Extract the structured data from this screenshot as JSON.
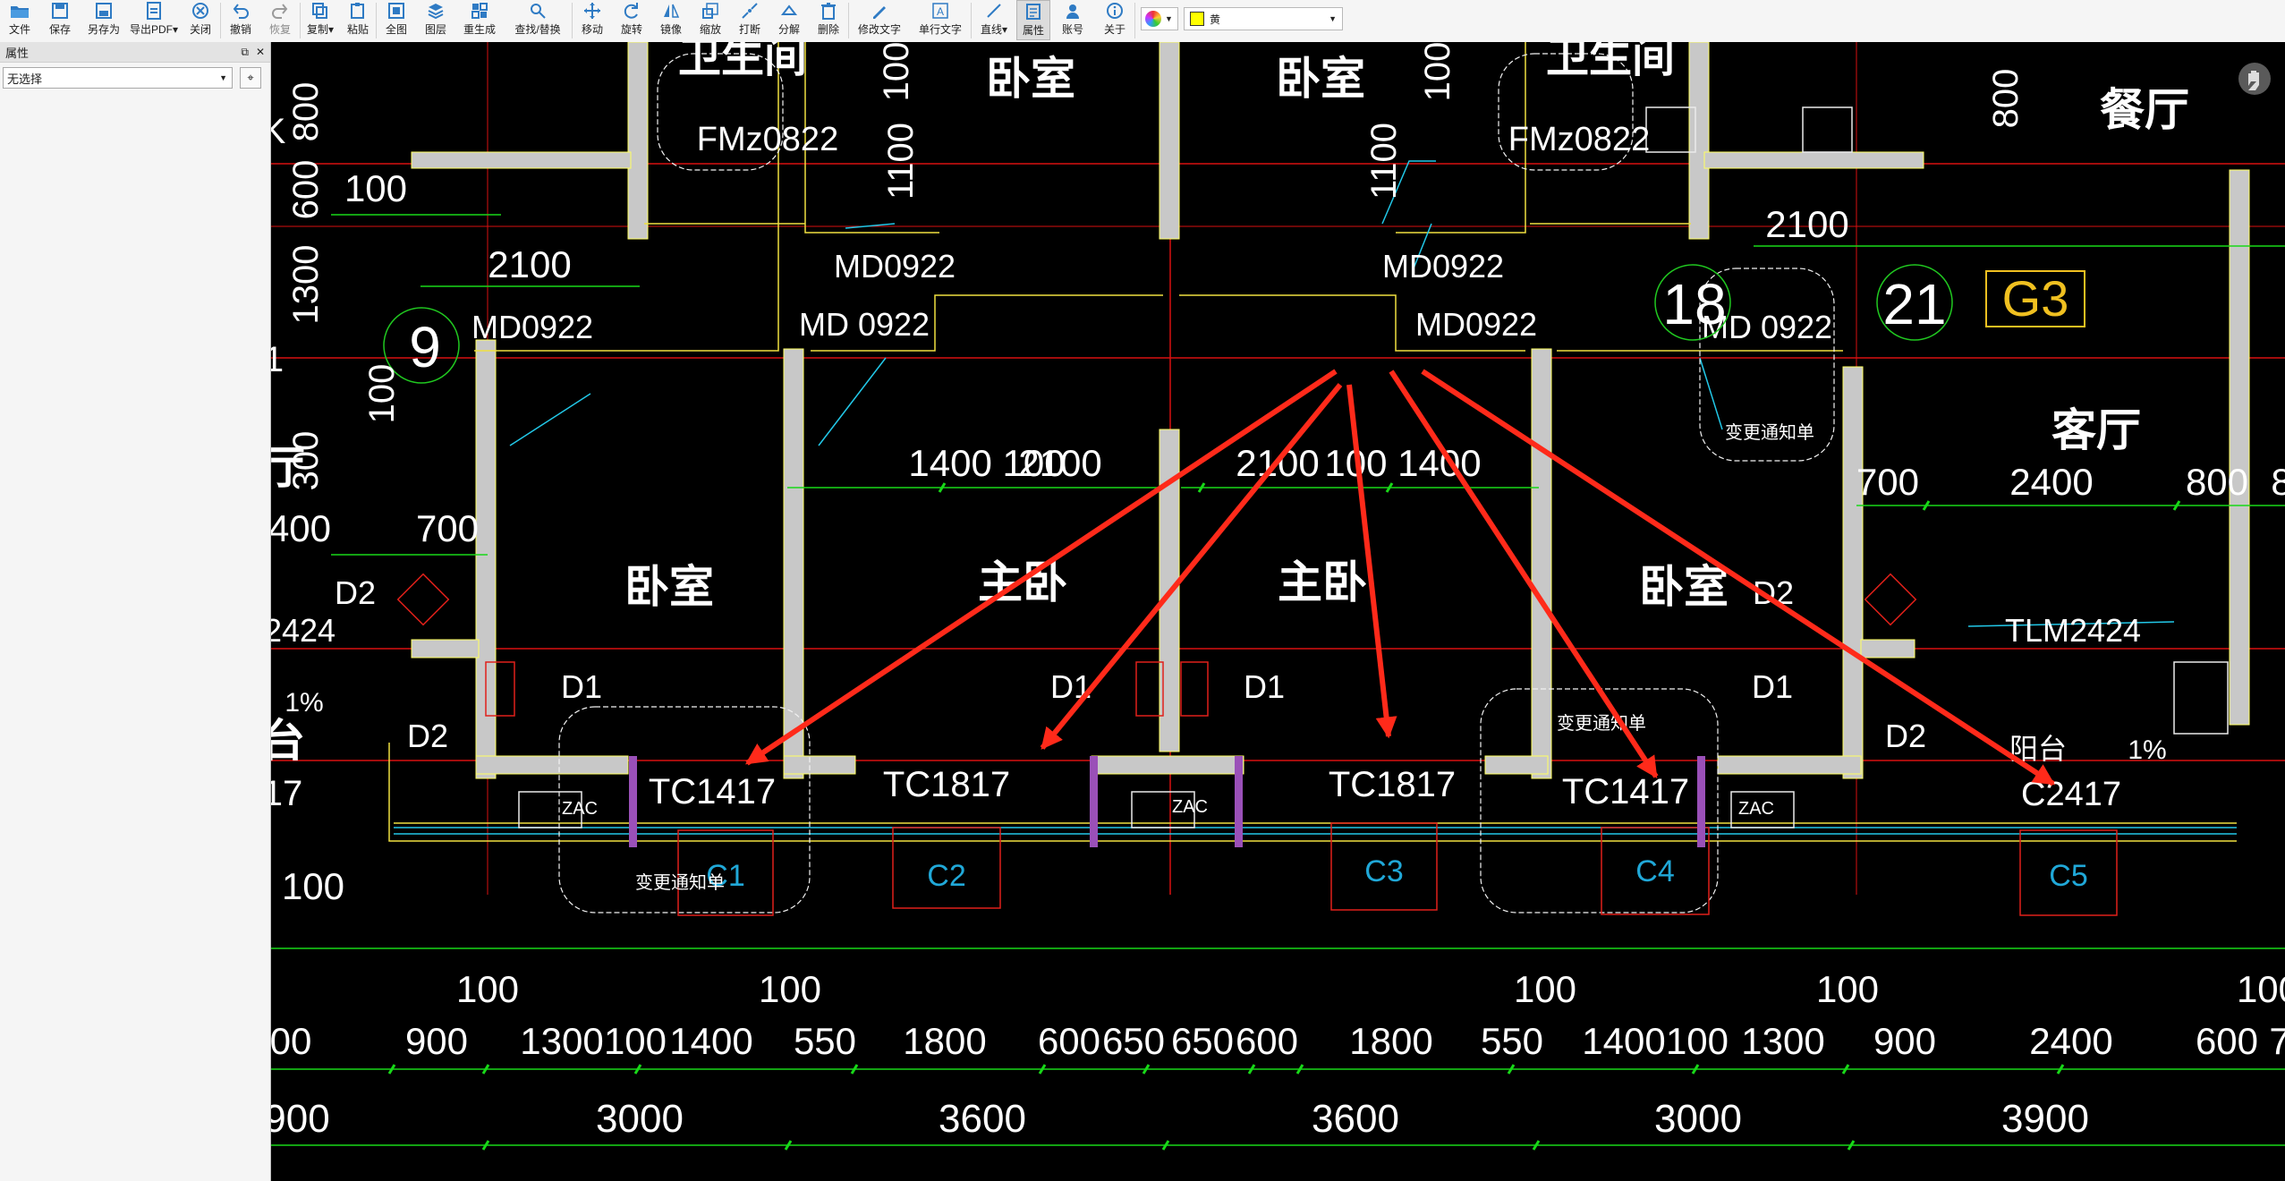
{
  "toolbar": {
    "buttons": [
      {
        "label": "文件",
        "icon": "folder-icon"
      },
      {
        "label": "保存",
        "icon": "save-icon"
      },
      {
        "label": "另存为",
        "icon": "save-as-icon"
      },
      {
        "label": "导出PDF▾",
        "icon": "export-pdf-icon"
      },
      {
        "label": "关闭",
        "icon": "close-icon"
      },
      {
        "label": "撤销",
        "icon": "undo-icon"
      },
      {
        "label": "恢复",
        "icon": "redo-icon"
      },
      {
        "label": "复制▾",
        "icon": "copy-icon"
      },
      {
        "label": "粘贴",
        "icon": "paste-icon"
      },
      {
        "label": "全图",
        "icon": "fit-view-icon"
      },
      {
        "label": "图层",
        "icon": "layers-icon"
      },
      {
        "label": "重生成",
        "icon": "regen-icon"
      },
      {
        "label": "查找/替换",
        "icon": "find-replace-icon"
      },
      {
        "label": "移动",
        "icon": "move-icon"
      },
      {
        "label": "旋转",
        "icon": "rotate-icon"
      },
      {
        "label": "镜像",
        "icon": "mirror-icon"
      },
      {
        "label": "缩放",
        "icon": "scale-icon"
      },
      {
        "label": "打断",
        "icon": "break-icon"
      },
      {
        "label": "分解",
        "icon": "explode-icon"
      },
      {
        "label": "删除",
        "icon": "delete-icon"
      },
      {
        "label": "修改文字",
        "icon": "edit-text-icon"
      },
      {
        "label": "单行文字",
        "icon": "single-line-text-icon"
      },
      {
        "label": "直线▾",
        "icon": "line-icon"
      },
      {
        "label": "属性",
        "icon": "properties-icon"
      },
      {
        "label": "账号",
        "icon": "account-icon"
      },
      {
        "label": "关于",
        "icon": "about-icon"
      }
    ],
    "color_value": "黄",
    "color_swatch": "#ffff00"
  },
  "panel": {
    "title": "属性",
    "selection": "无选择"
  },
  "drawing": {
    "rooms": {
      "bath_left": "卫生间",
      "bed_top1": "卧室",
      "bed_top2": "卧室",
      "bath_right": "卫生间",
      "dining": "餐厅",
      "living": "客厅",
      "bed_left": "卧室",
      "master1": "主卧",
      "master2": "主卧",
      "bed_right": "卧室",
      "hall_left": "厅",
      "balcony_left": "台",
      "balcony_right": "阳台"
    },
    "tags": {
      "fm1": "FMz0822",
      "fm2": "FMz0822",
      "md1": "MD0922",
      "md2": "MD0922",
      "md3": "MD 0922",
      "md4": "MD0922",
      "md5": "MD0922",
      "md6": "MD 0922",
      "tc1": "TC1417",
      "tc2": "TC1817",
      "tc3": "TC1817",
      "tc4": "TC1417",
      "c2417": "C2417",
      "tlm_left": "2424",
      "tlm_right": "TLM2424",
      "d1a": "D1",
      "d1b": "D1",
      "d1c": "D1",
      "d1d": "D1",
      "d2a": "D2",
      "d2b": "D2",
      "d2c": "D2",
      "d2d": "D2",
      "g3": "G3",
      "grid9": "9",
      "grid18": "18",
      "grid21": "21",
      "slope1": "1%",
      "slope2": "1%",
      "zac1": "ZAC",
      "zac2": "ZAC",
      "zac3": "ZAC",
      "change1": "变更通知单",
      "change2": "变更通知单",
      "change3": "变更通知单",
      "left_k": "K",
      "left_17": "17",
      "left_1": "1"
    },
    "boxes": [
      "C1",
      "C2",
      "C3",
      "C4",
      "C5"
    ],
    "dims": {
      "d100a": "100",
      "d2100a": "2100",
      "d800a": "800",
      "d600a": "600",
      "d1300a": "1300",
      "d100v": "100",
      "d300": "300",
      "d400": "400",
      "d700a": "700",
      "d1400a": "1400 100",
      "d2100b": "2100",
      "d2100c": "2100",
      "d1400b": "100 1400",
      "d700b": "700",
      "d2400a": "2400",
      "d800b": "800",
      "d8": "8",
      "d2100d": "2100",
      "d800c": "800",
      "d1100a": "1100",
      "d1100b": "1100",
      "d100top": "100",
      "d100r": "100",
      "d900a": "900",
      "row1": [
        "100",
        "100",
        "100",
        "100",
        "100"
      ],
      "row2": [
        "00",
        "900",
        "1300",
        "100",
        "1400",
        "550",
        "1800",
        "600",
        "650",
        "650",
        "600",
        "1800",
        "550",
        "1400",
        "100",
        "1300",
        "900",
        "2400",
        "600",
        "7"
      ],
      "row3": [
        "900",
        "3000",
        "3600",
        "3600",
        "3000",
        "3900"
      ]
    }
  }
}
